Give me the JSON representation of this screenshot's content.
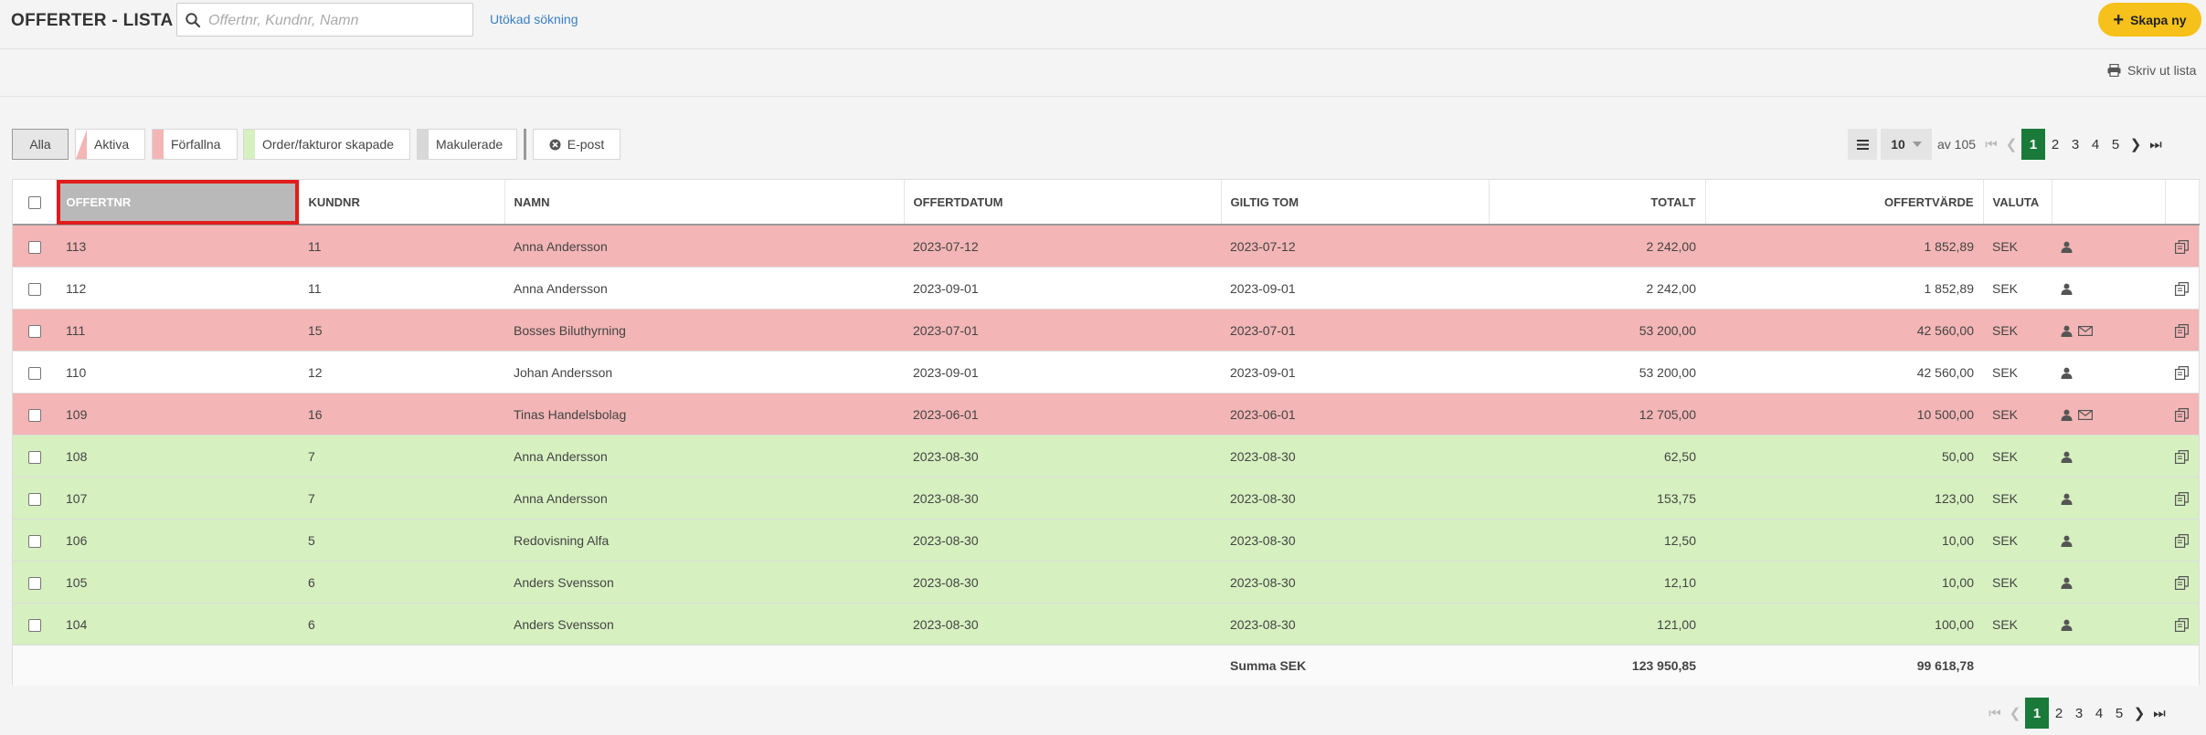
{
  "header": {
    "title": "OFFERTER - LISTA",
    "search_placeholder": "Offertnr, Kundnr, Namn",
    "advanced_search": "Utökad sökning",
    "create_label": "Skapa ny"
  },
  "toolbar": {
    "print_label": "Skriv ut lista"
  },
  "filters": [
    {
      "label": "Alla",
      "color": "#e6e6e6"
    },
    {
      "label": "Aktiva",
      "color": "#f3b5b5"
    },
    {
      "label": "Förfallna",
      "color": "#f3b5b5"
    },
    {
      "label": "Order/fakturor skapade",
      "color": "#d6f0c0"
    },
    {
      "label": "Makulerade",
      "color": "#d8d8d8"
    },
    {
      "label": "E-post",
      "color": "#ffffff"
    }
  ],
  "pagination": {
    "per_page": "10",
    "of_text": "av 105",
    "pages": [
      "1",
      "2",
      "3",
      "4",
      "5"
    ],
    "current_page": "1"
  },
  "table": {
    "columns": [
      "OFFERTNR",
      "KUNDNR",
      "NAMN",
      "OFFERTDATUM",
      "GILTIG TOM",
      "TOTALT",
      "OFFERTVÄRDE",
      "VALUTA"
    ],
    "rows": [
      {
        "status": "red",
        "offertnr": "113",
        "kundnr": "11",
        "namn": "Anna Andersson",
        "offertdatum": "2023-07-12",
        "giltig": "2023-07-12",
        "totalt": "2 242,00",
        "varde": "1 852,89",
        "valuta": "SEK",
        "mail": false
      },
      {
        "status": "white",
        "offertnr": "112",
        "kundnr": "11",
        "namn": "Anna Andersson",
        "offertdatum": "2023-09-01",
        "giltig": "2023-09-01",
        "totalt": "2 242,00",
        "varde": "1 852,89",
        "valuta": "SEK",
        "mail": false
      },
      {
        "status": "red",
        "offertnr": "111",
        "kundnr": "15",
        "namn": "Bosses Biluthyrning",
        "offertdatum": "2023-07-01",
        "giltig": "2023-07-01",
        "totalt": "53 200,00",
        "varde": "42 560,00",
        "valuta": "SEK",
        "mail": true
      },
      {
        "status": "white",
        "offertnr": "110",
        "kundnr": "12",
        "namn": "Johan Andersson",
        "offertdatum": "2023-09-01",
        "giltig": "2023-09-01",
        "totalt": "53 200,00",
        "varde": "42 560,00",
        "valuta": "SEK",
        "mail": false
      },
      {
        "status": "red",
        "offertnr": "109",
        "kundnr": "16",
        "namn": "Tinas Handelsbolag",
        "offertdatum": "2023-06-01",
        "giltig": "2023-06-01",
        "totalt": "12 705,00",
        "varde": "10 500,00",
        "valuta": "SEK",
        "mail": true
      },
      {
        "status": "green",
        "offertnr": "108",
        "kundnr": "7",
        "namn": "Anna Andersson",
        "offertdatum": "2023-08-30",
        "giltig": "2023-08-30",
        "totalt": "62,50",
        "varde": "50,00",
        "valuta": "SEK",
        "mail": false
      },
      {
        "status": "green",
        "offertnr": "107",
        "kundnr": "7",
        "namn": "Anna Andersson",
        "offertdatum": "2023-08-30",
        "giltig": "2023-08-30",
        "totalt": "153,75",
        "varde": "123,00",
        "valuta": "SEK",
        "mail": false
      },
      {
        "status": "green",
        "offertnr": "106",
        "kundnr": "5",
        "namn": "Redovisning Alfa",
        "offertdatum": "2023-08-30",
        "giltig": "2023-08-30",
        "totalt": "12,50",
        "varde": "10,00",
        "valuta": "SEK",
        "mail": false
      },
      {
        "status": "green",
        "offertnr": "105",
        "kundnr": "6",
        "namn": "Anders Svensson",
        "offertdatum": "2023-08-30",
        "giltig": "2023-08-30",
        "totalt": "12,10",
        "varde": "10,00",
        "valuta": "SEK",
        "mail": false
      },
      {
        "status": "green",
        "offertnr": "104",
        "kundnr": "6",
        "namn": "Anders Svensson",
        "offertdatum": "2023-08-30",
        "giltig": "2023-08-30",
        "totalt": "121,00",
        "varde": "100,00",
        "valuta": "SEK",
        "mail": false
      }
    ],
    "summary": {
      "label": "Summa SEK",
      "totalt": "123 950,85",
      "varde": "99 618,78"
    }
  },
  "icons": {
    "search": "search-icon",
    "plus": "plus-icon",
    "print": "printer-icon",
    "email": "close-circle-icon",
    "menu": "list-icon",
    "user": "user-icon",
    "mail": "envelope-icon",
    "copy": "copy-icon"
  },
  "colors": {
    "accent": "#f5c11a",
    "current_page": "#1a7a3a",
    "expired_row": "#f3b5b5",
    "created_row": "#d6f0c0",
    "link": "#3a7fc1",
    "focus_outline": "#e21b1b"
  }
}
